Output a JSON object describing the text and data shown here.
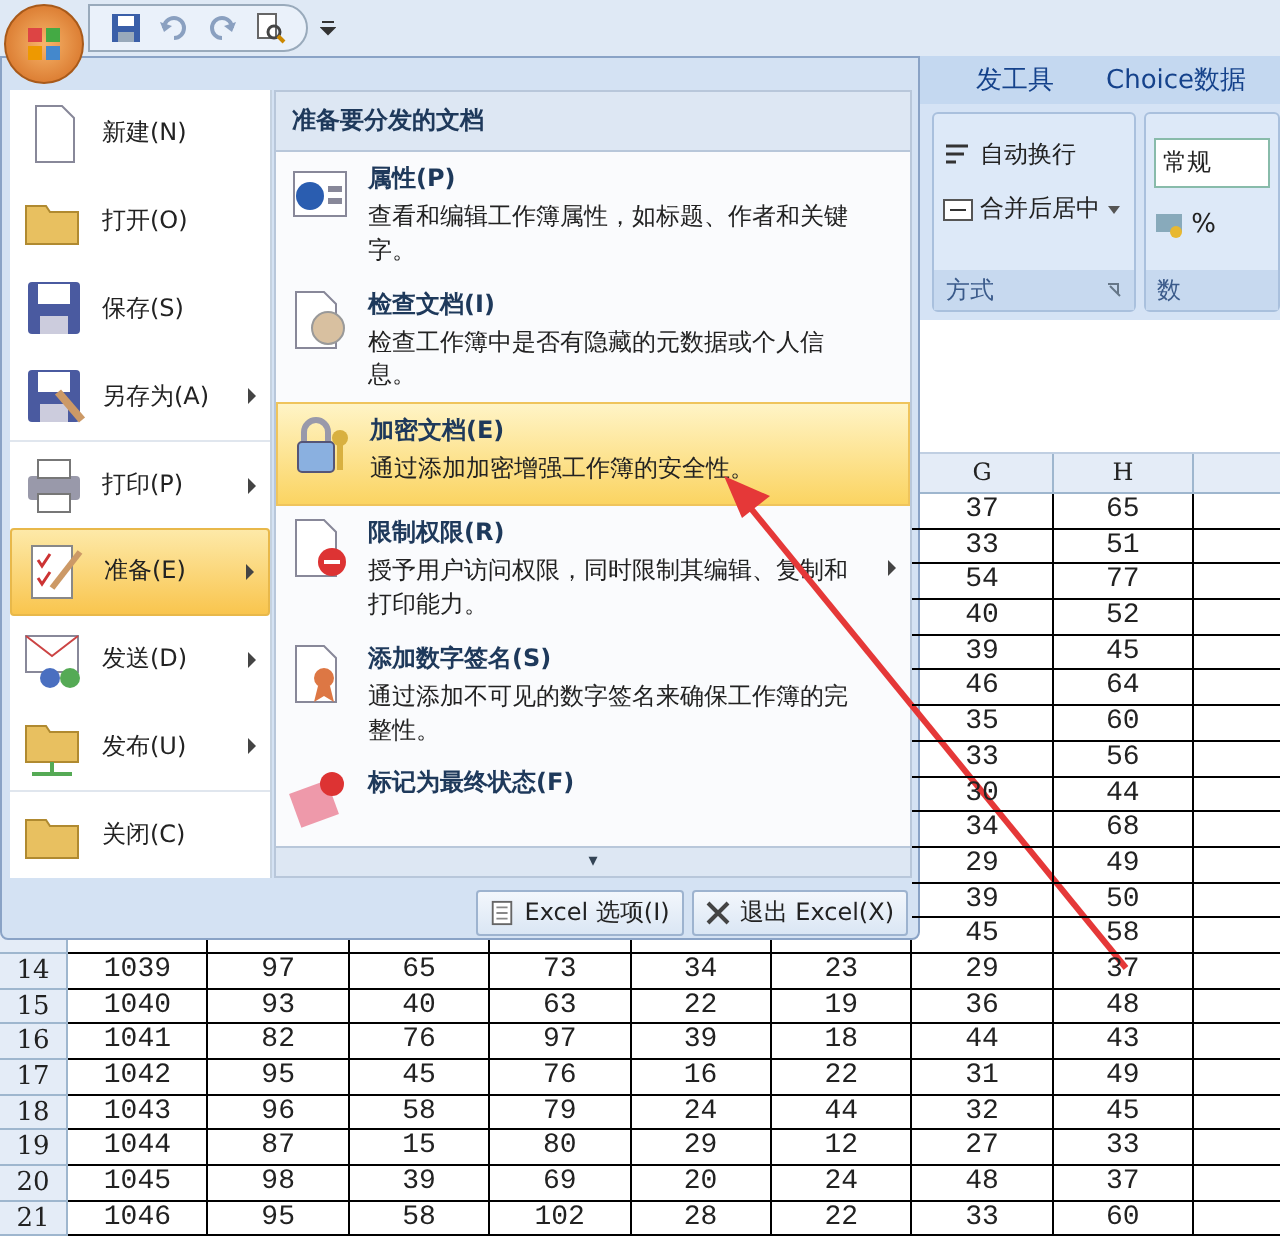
{
  "ribbon": {
    "tabs": [
      {
        "label": "发工具"
      },
      {
        "label": "Choice数据"
      }
    ],
    "wrap_text": "自动换行",
    "merge_center": "合并后居中",
    "group_label": "方式",
    "number_format": "常规",
    "percent": "%",
    "number_group_label": "数"
  },
  "grid": {
    "columns": [
      "G",
      "H",
      ""
    ],
    "rows": [
      {
        "g": "37",
        "h": "65"
      },
      {
        "g": "33",
        "h": "51"
      },
      {
        "g": "54",
        "h": "77"
      },
      {
        "g": "40",
        "h": "52"
      },
      {
        "g": "39",
        "h": "45"
      },
      {
        "g": "46",
        "h": "64"
      },
      {
        "g": "35",
        "h": "60"
      },
      {
        "g": "33",
        "h": "56"
      },
      {
        "g": "30",
        "h": "44"
      },
      {
        "g": "34",
        "h": "68"
      },
      {
        "g": "29",
        "h": "49"
      },
      {
        "g": "39",
        "h": "50"
      },
      {
        "g": "45",
        "h": "58"
      },
      {
        "num": "14",
        "cells": [
          "1039",
          "97",
          "65",
          "73",
          "34",
          "23"
        ],
        "g": "29",
        "h": "37"
      },
      {
        "num": "15",
        "cells": [
          "1040",
          "93",
          "40",
          "63",
          "22",
          "19"
        ],
        "g": "36",
        "h": "48"
      },
      {
        "num": "16",
        "cells": [
          "1041",
          "82",
          "76",
          "97",
          "39",
          "18"
        ],
        "g": "44",
        "h": "43"
      },
      {
        "num": "17",
        "cells": [
          "1042",
          "95",
          "45",
          "76",
          "16",
          "22"
        ],
        "g": "31",
        "h": "49"
      },
      {
        "num": "18",
        "cells": [
          "1043",
          "96",
          "58",
          "79",
          "24",
          "44"
        ],
        "g": "32",
        "h": "45"
      },
      {
        "num": "19",
        "cells": [
          "1044",
          "87",
          "15",
          "80",
          "29",
          "12"
        ],
        "g": "27",
        "h": "33"
      },
      {
        "num": "20",
        "cells": [
          "1045",
          "98",
          "39",
          "69",
          "20",
          "24"
        ],
        "g": "48",
        "h": "37"
      },
      {
        "num": "21",
        "cells": [
          "1046",
          "95",
          "58",
          "102",
          "28",
          "22"
        ],
        "g": "33",
        "h": "60"
      }
    ]
  },
  "office_menu": {
    "left_items": [
      {
        "label": "新建(N)",
        "submenu": false,
        "selected": false
      },
      {
        "label": "打开(O)",
        "submenu": false,
        "selected": false
      },
      {
        "label": "保存(S)",
        "submenu": false,
        "selected": false
      },
      {
        "label": "另存为(A)",
        "submenu": true,
        "selected": false
      },
      {
        "label": "打印(P)",
        "submenu": true,
        "selected": false
      },
      {
        "label": "准备(E)",
        "submenu": true,
        "selected": true
      },
      {
        "label": "发送(D)",
        "submenu": true,
        "selected": false
      },
      {
        "label": "发布(U)",
        "submenu": true,
        "selected": false
      },
      {
        "label": "关闭(C)",
        "submenu": false,
        "selected": false
      }
    ],
    "submenu": {
      "title": "准备要分发的文档",
      "items": [
        {
          "title": "属性(P)",
          "description": "查看和编辑工作簿属性，如标题、作者和关键字。",
          "submenu": false,
          "selected": false
        },
        {
          "title": "检查文档(I)",
          "description": "检查工作簿中是否有隐藏的元数据或个人信息。",
          "submenu": false,
          "selected": false
        },
        {
          "title": "加密文档(E)",
          "description": "通过添加加密增强工作簿的安全性。",
          "submenu": false,
          "selected": true
        },
        {
          "title": "限制权限(R)",
          "description": "授予用户访问权限，同时限制其编辑、复制和打印能力。",
          "submenu": true,
          "selected": false
        },
        {
          "title": "添加数字签名(S)",
          "description": "通过添加不可见的数字签名来确保工作簿的完整性。",
          "submenu": false,
          "selected": false
        },
        {
          "title": "标记为最终状态(F)",
          "submenu": false,
          "selected": false
        }
      ],
      "scroll_glyph": "▾"
    },
    "footer_buttons": [
      "Excel 选项(I)",
      "退出 Excel(X)"
    ]
  }
}
